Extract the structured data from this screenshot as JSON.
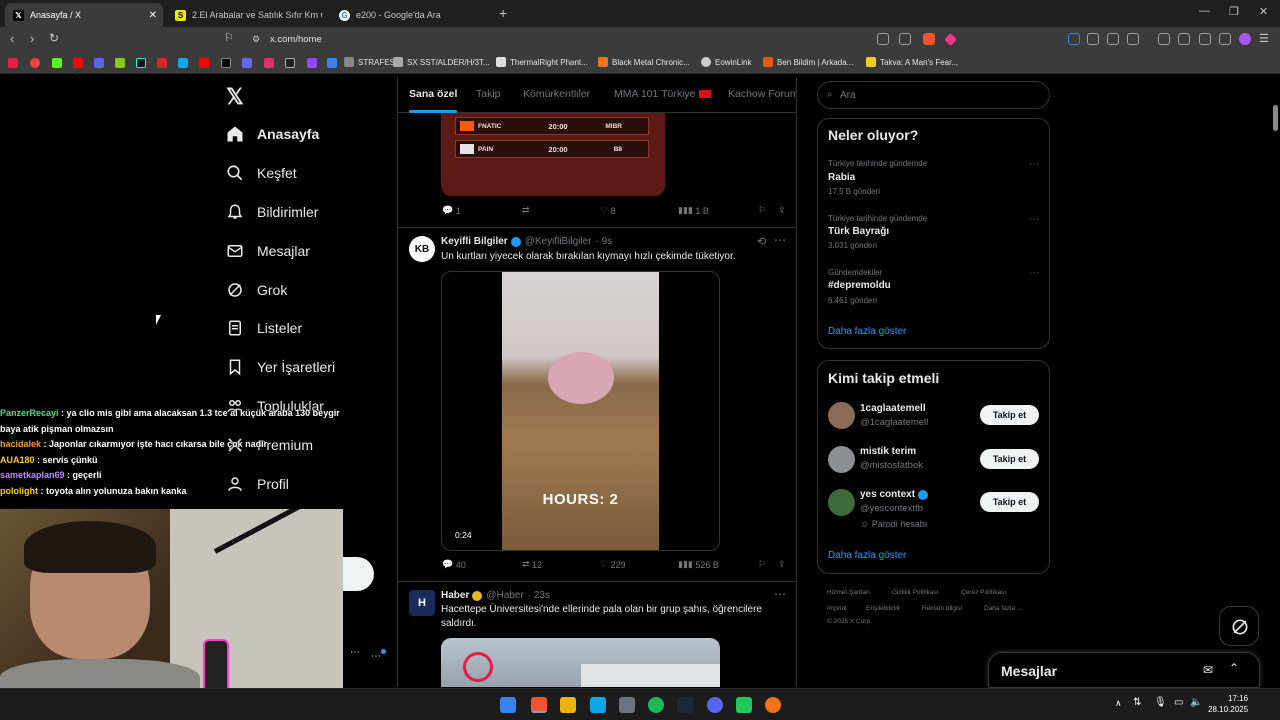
{
  "browser": {
    "tabs": [
      {
        "title": "Anasayfa / X",
        "active": true
      },
      {
        "title": "2.El Arabalar ve Satılık Sıfır Km Otom...",
        "active": false
      },
      {
        "title": "e200 - Google'da Ara",
        "active": false
      }
    ],
    "url": "x.com/home",
    "bookmarks": [
      "STRAFES.io",
      "SX SST/ALDER/H/3T...",
      "ThermalRight Phant...",
      "Black Metal Chronic...",
      "EowinLink",
      "Ben Bildim | Arkada...",
      "Takva: A Man's Fear..."
    ]
  },
  "nav": {
    "items": [
      "Anasayfa",
      "Keşfet",
      "Bildirimler",
      "Mesajlar",
      "Grok",
      "Listeler",
      "Yer İşaretleri",
      "Topluluklar",
      "Premium",
      "Profil"
    ]
  },
  "feed": {
    "tabs": [
      "Sana özel",
      "Takip",
      "Kömürkentliler",
      "MMA 101 Türkiye",
      "Kachow Forum"
    ],
    "match_rows": [
      {
        "team1": "FNATIC",
        "time": "20:00",
        "sub": "BO3",
        "team2": "MIBR"
      },
      {
        "team1": "PAIN",
        "time": "20:00",
        "sub": "BO3",
        "team2": "B8"
      }
    ],
    "post0_actions": {
      "replies": "1",
      "reposts": "",
      "likes": "8",
      "views": "1 B"
    },
    "post1": {
      "name": "Keyifli Bilgiler",
      "handle": "@KeyifliBilgiler",
      "time": "· 9s",
      "text": "Un kurtları yiyecek olarak bırakılan kıymayı hızlı çekimde tüketiyor.",
      "video_caption": "HOURS: 2",
      "duration": "0:24",
      "replies": "40",
      "reposts": "12",
      "likes": "229",
      "views": "526 B"
    },
    "post2": {
      "name": "Haber",
      "handle": "@Haber",
      "time": "· 23s",
      "text": "Hacettepe Üniversitesi'nde ellerinde pala olan bir grup şahıs, öğrencilere saldırdı."
    }
  },
  "sidebar": {
    "search_placeholder": "Ara",
    "trends_title": "Neler oluyor?",
    "trends": [
      {
        "context": "Türkiye tarihinde gündemde",
        "name": "Rabia",
        "count": "17,5 B gönderi"
      },
      {
        "context": "Türkiye tarihinde gündemde",
        "name": "Türk Bayrağı",
        "count": "3.031 gönderi"
      },
      {
        "context": "Gündemdekiler",
        "name": "#depremoldu",
        "count": "6.461 gönderi"
      }
    ],
    "show_more": "Daha fazla göster",
    "who_title": "Kimi takip etmeli",
    "who": [
      {
        "name": "1caglaatemell",
        "handle": "@1caglaatemell",
        "extra": ""
      },
      {
        "name": "mistik terim",
        "handle": "@mistosfatbok",
        "extra": ""
      },
      {
        "name": "yes context",
        "handle": "@yescontextfb",
        "extra": "Parodi hesabı"
      }
    ],
    "follow_label": "Takip et",
    "footer": [
      "Hizmet Şartları",
      "Gizlilik Politikası",
      "Çerez Politikası",
      "Imprint",
      "Erişilebilirlik",
      "Reklam bilgisi",
      "Daha fazla ...",
      "© 2025 X Corp."
    ]
  },
  "messages_label": "Mesajlar",
  "chat": [
    {
      "user": "PanzerRecayi",
      "color": "#4ade80",
      "text": " : ya clio mis gibi ama alacaksan 1.3 tce al küçük araba 130 beygir"
    },
    {
      "user": "",
      "color": "#ffffff",
      "text": "baya        atik pişman olmazsın"
    },
    {
      "user": "hacidalek",
      "color": "#f59e0b",
      "text": " : Japonlar cıkarmıyor işte hacı cıkarsa bile çok nadir"
    },
    {
      "user": "AUA180",
      "color": "#facc15",
      "text": " : servis çünkü"
    },
    {
      "user": "sametkaplan69",
      "color": "#c084fc",
      "text": " : geçerli"
    },
    {
      "user": "pololight",
      "color": "#facc15",
      "text": " : toyota alın yolunuza bakın kanka"
    }
  ],
  "clock": {
    "time": "17:16",
    "date": "28.10.2025"
  }
}
